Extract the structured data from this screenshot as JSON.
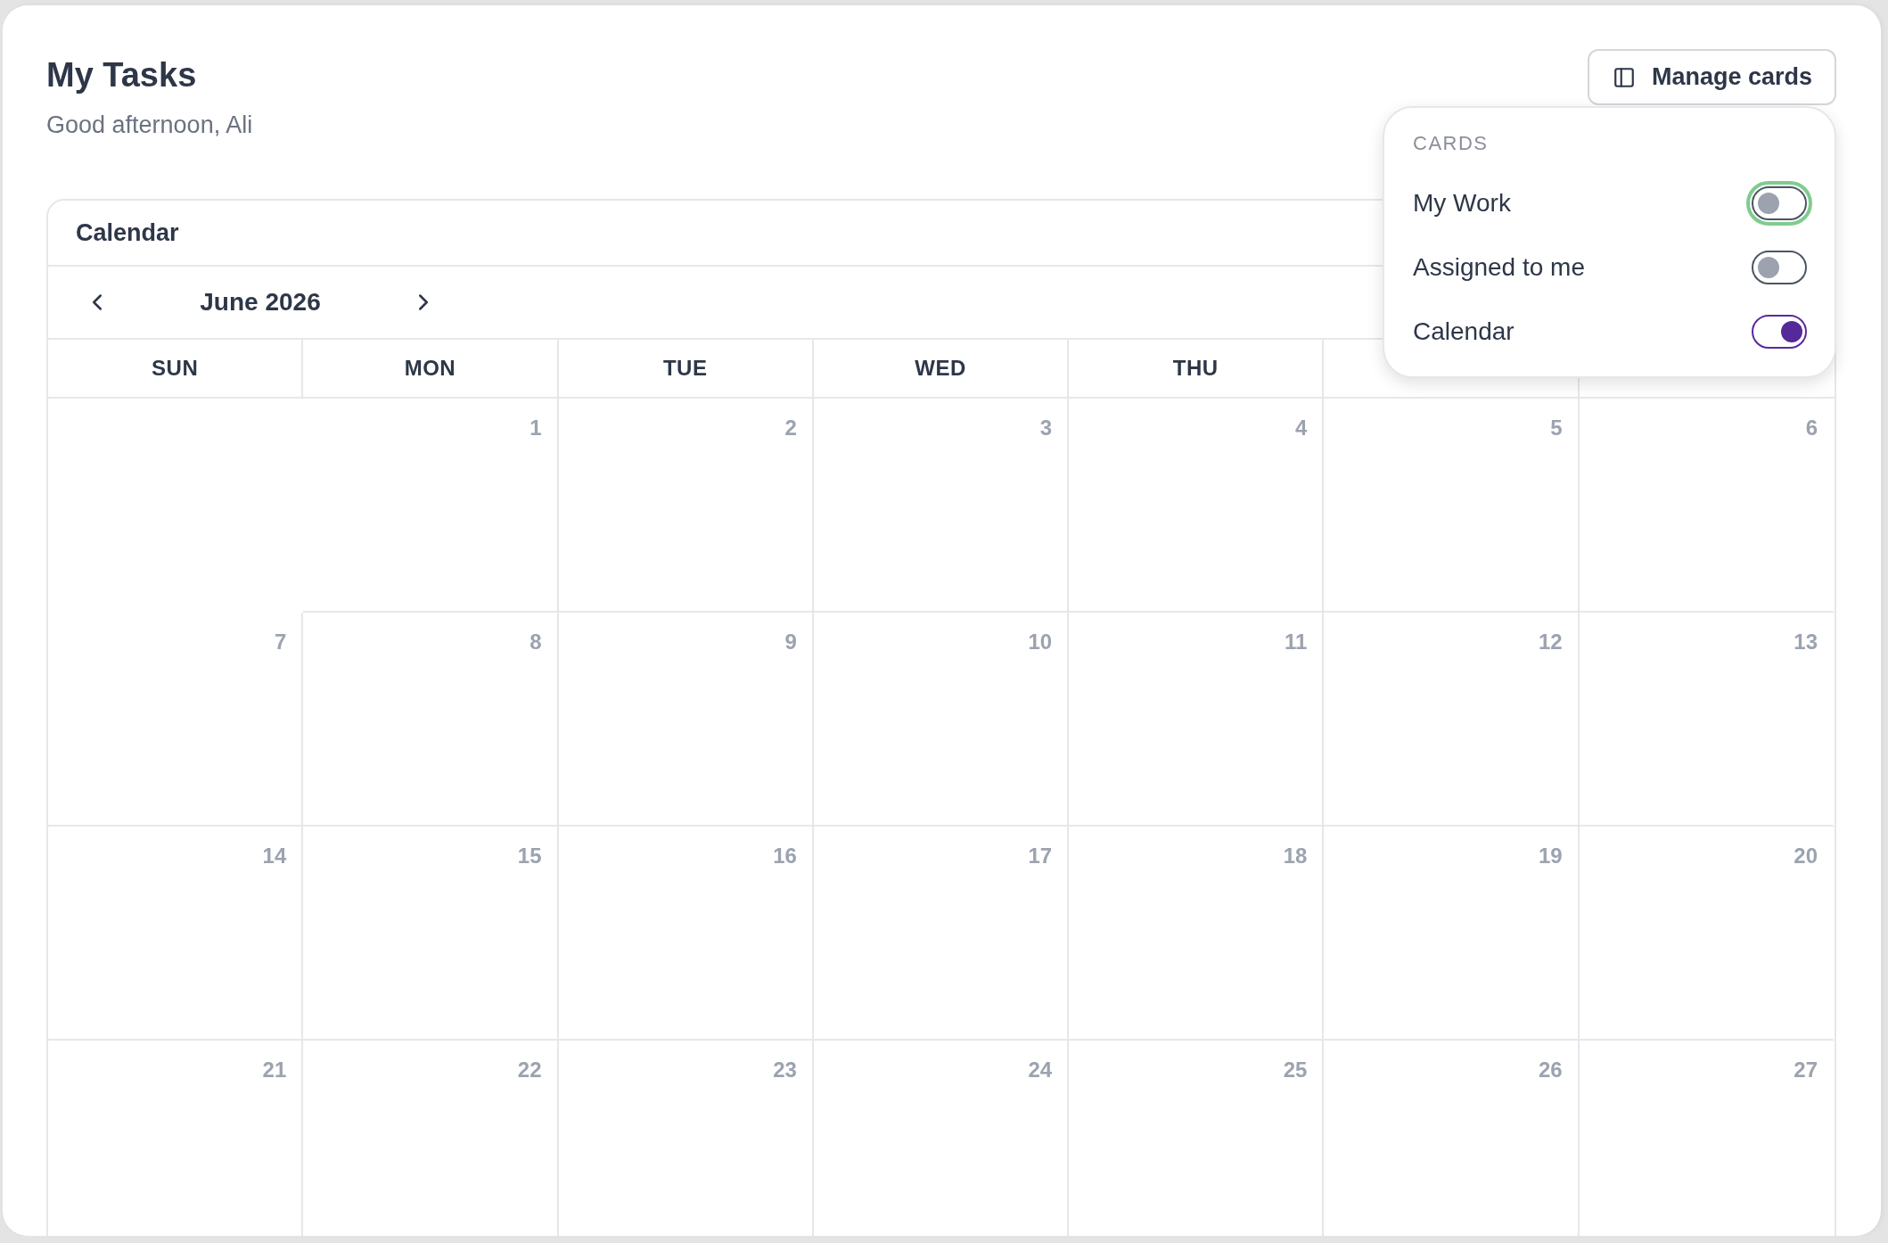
{
  "page": {
    "title": "My Tasks",
    "subtitle": "Good afternoon, Ali"
  },
  "manage_cards_button": {
    "label": "Manage cards"
  },
  "cards_menu": {
    "heading": "CARDS",
    "items": [
      {
        "label": "My Work",
        "on": false,
        "focused": true
      },
      {
        "label": "Assigned to me",
        "on": false,
        "focused": false
      },
      {
        "label": "Calendar",
        "on": true,
        "focused": false
      }
    ]
  },
  "calendar": {
    "title": "Calendar",
    "month": "June 2026",
    "weekdays": [
      "SUN",
      "MON",
      "TUE",
      "WED",
      "THU"
    ],
    "weeks": [
      {
        "days": [
          "1",
          "2",
          "3",
          "4",
          "5",
          "6"
        ]
      },
      {
        "days": [
          "7",
          "8",
          "9",
          "10",
          "11",
          "12",
          "13"
        ]
      },
      {
        "days": [
          "14",
          "15",
          "16",
          "17",
          "18",
          "19",
          "20"
        ]
      },
      {
        "days": [
          "21",
          "22",
          "23",
          "24",
          "25",
          "26",
          "27"
        ]
      }
    ]
  }
}
